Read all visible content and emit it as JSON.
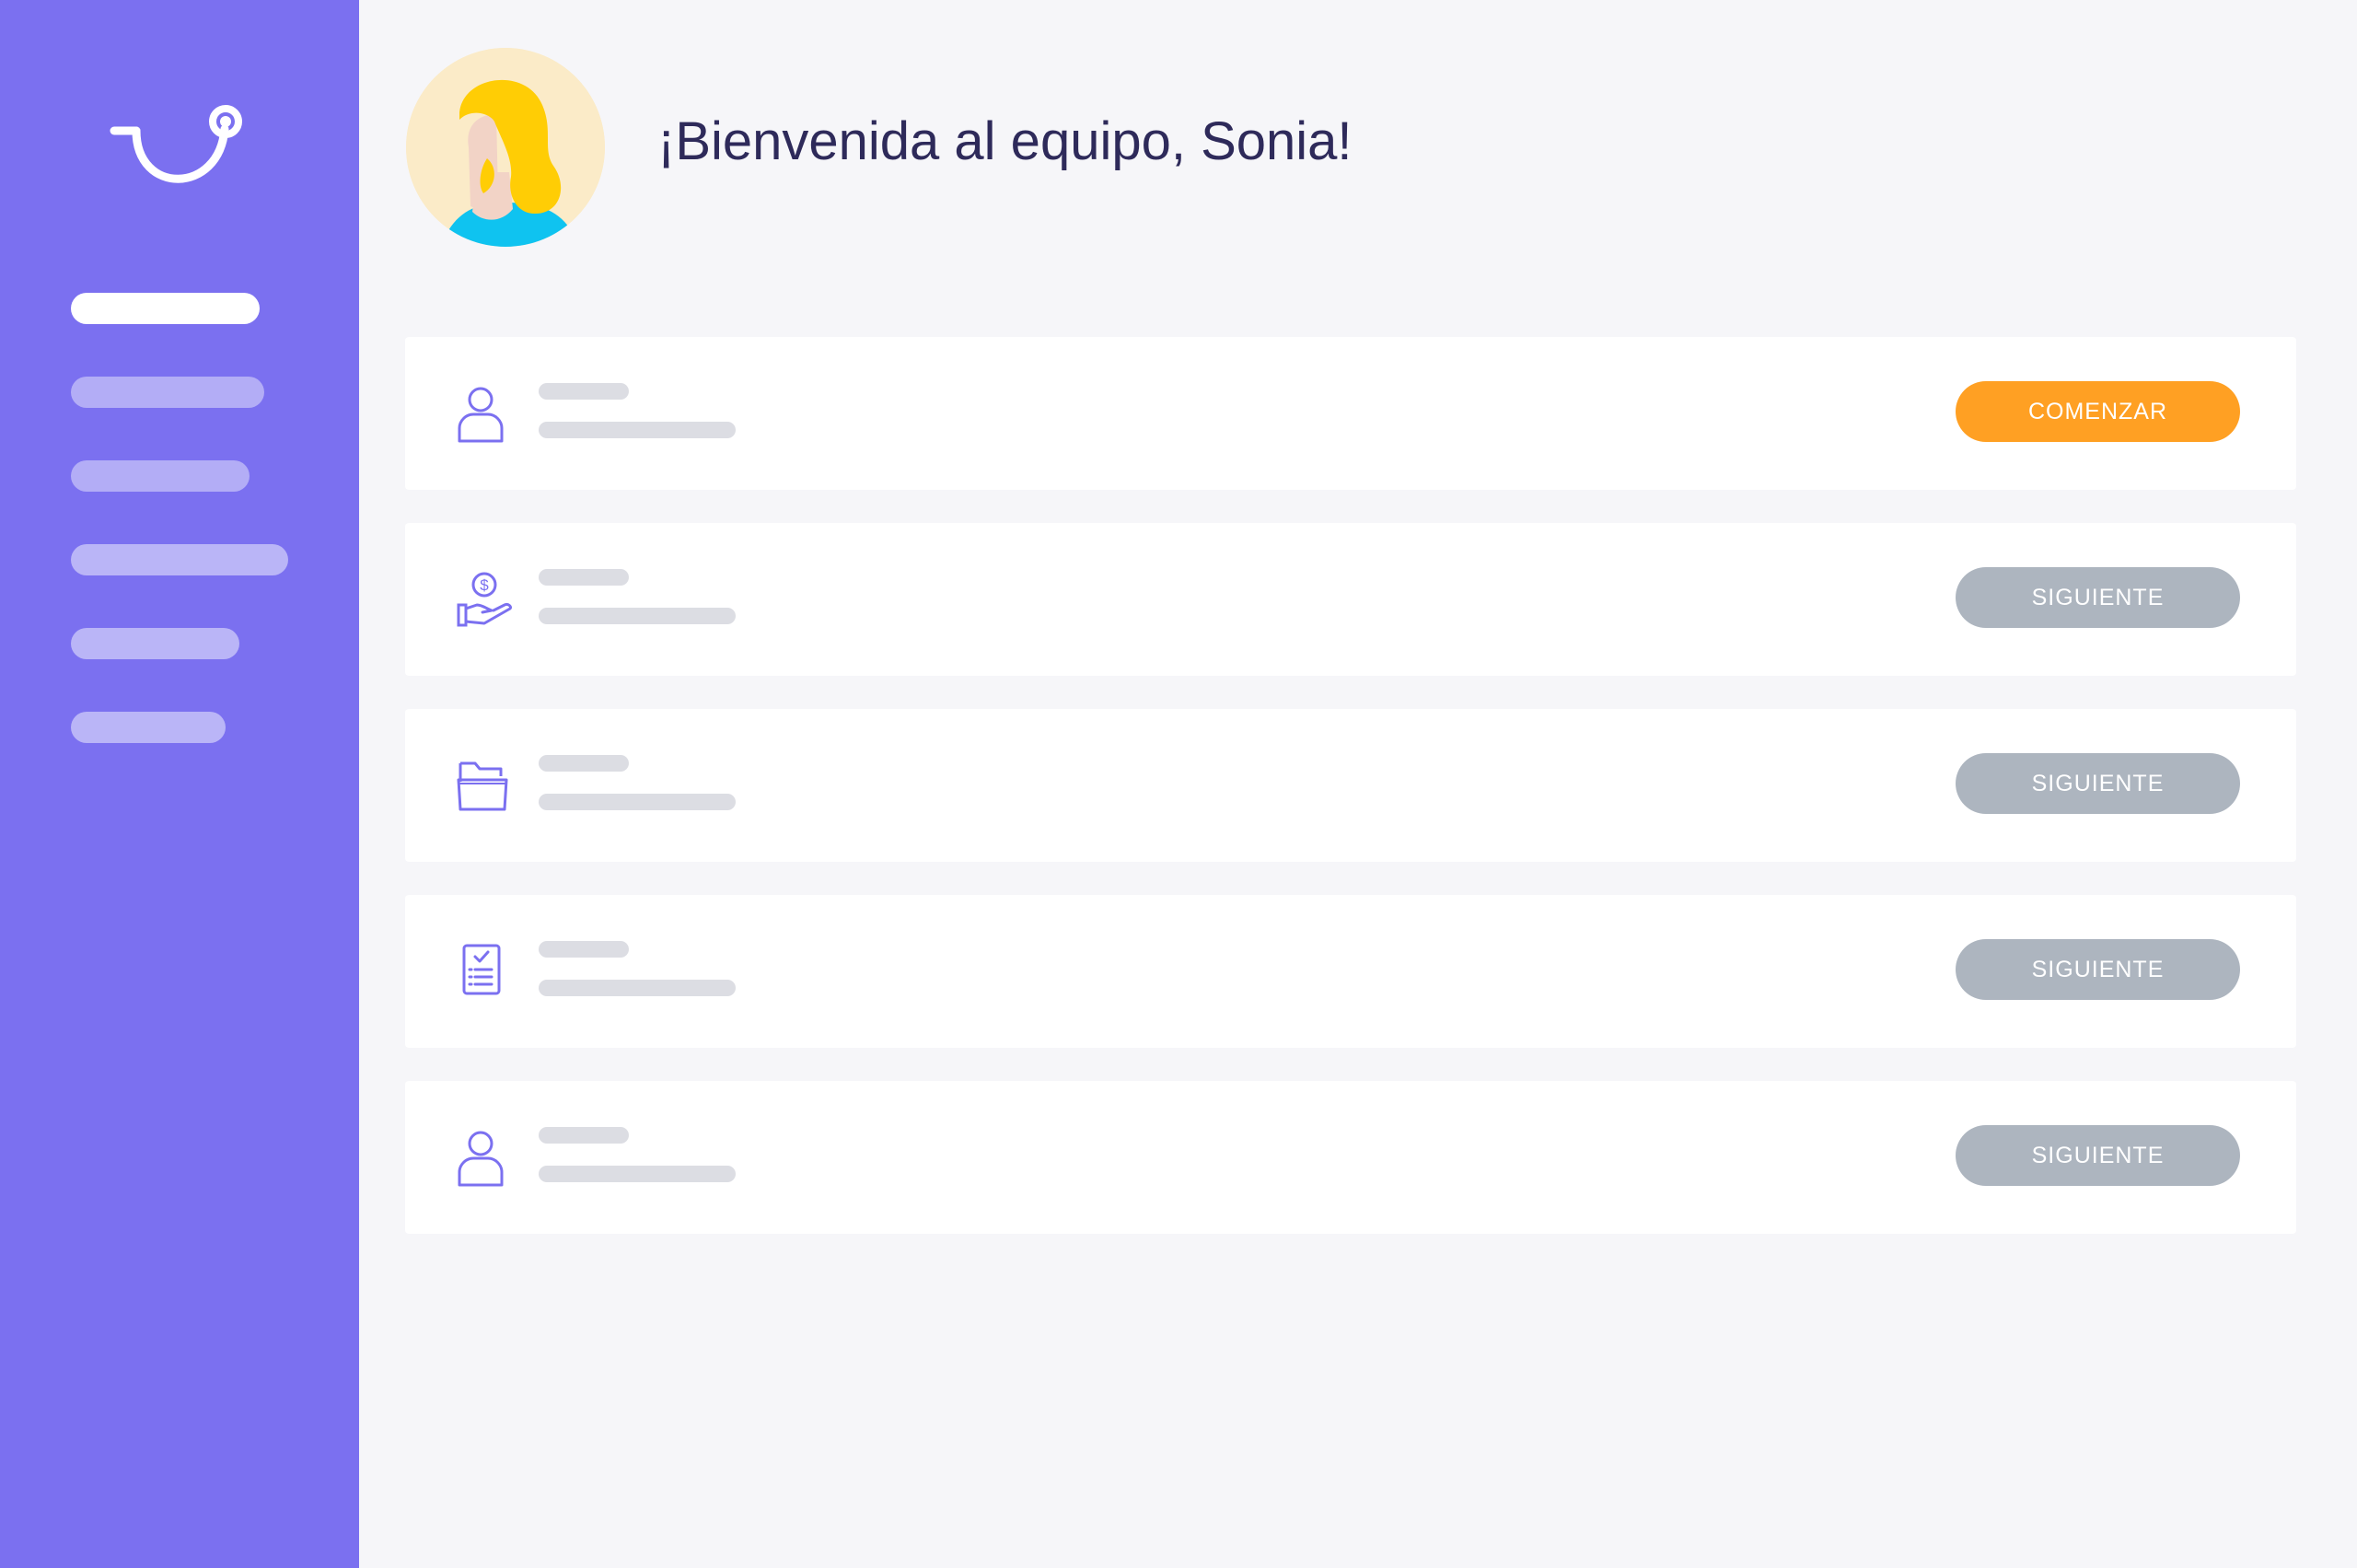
{
  "header": {
    "welcome_text": "¡Bienvenida al equipo, Sonia!"
  },
  "sidebar": {
    "logo_icon": "app-logo-icon",
    "items": [
      {
        "state": "active"
      },
      {
        "state": "inactive"
      },
      {
        "state": "inactive"
      },
      {
        "state": "inactive"
      },
      {
        "state": "inactive"
      },
      {
        "state": "inactive"
      }
    ]
  },
  "tasks": [
    {
      "icon": "user-icon",
      "button_label": "COMENZAR",
      "button_state": "primary"
    },
    {
      "icon": "hand-money-icon",
      "button_label": "SIGUIENTE",
      "button_state": "disabled"
    },
    {
      "icon": "folder-icon",
      "button_label": "SIGUIENTE",
      "button_state": "disabled"
    },
    {
      "icon": "checklist-icon",
      "button_label": "SIGUIENTE",
      "button_state": "disabled"
    },
    {
      "icon": "user-icon",
      "button_label": "SIGUIENTE",
      "button_state": "disabled"
    }
  ],
  "colors": {
    "sidebar": "#7b70f0",
    "primary_button": "#ffa023",
    "secondary_button": "#adb5bf",
    "heading_text": "#2e2a5a",
    "icon_stroke": "#7b70f0"
  }
}
